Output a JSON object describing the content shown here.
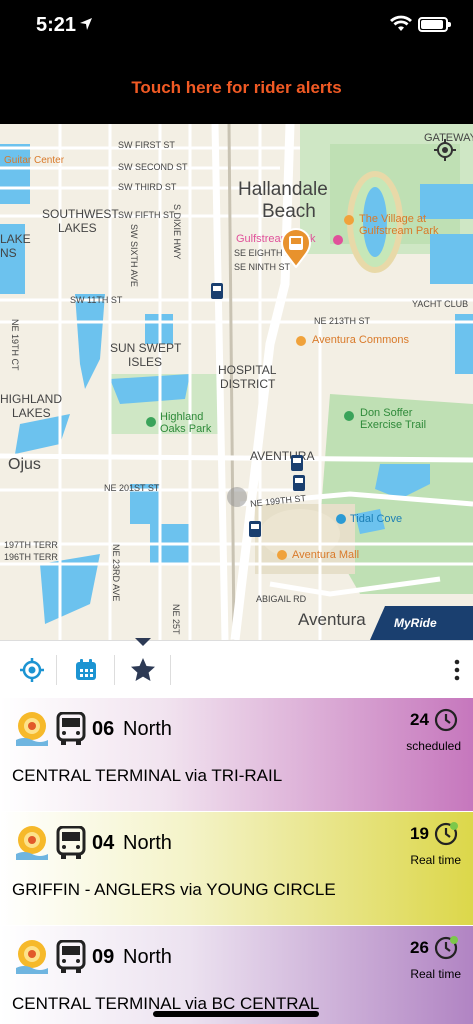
{
  "status_bar": {
    "time": "5:21"
  },
  "alert_banner": {
    "text": "Touch here for rider alerts"
  },
  "map": {
    "labels": {
      "guitar_center": "Guitar Center",
      "sw_first_st": "SW FIRST ST",
      "sw_second_st": "SW SECOND ST",
      "sw_third_st": "SW THIRD ST",
      "sw_fifth_st": "SW FIFTH ST",
      "s_dixie_hwy": "S DIXIE HWY",
      "hallandale": "Hallandale",
      "beach": "Beach",
      "gateway": "GATEWAY",
      "southwest": "SOUTHWEST",
      "lakes": "LAKES",
      "lake_partial": "LAKE",
      "ns_partial": "NS",
      "gulfstream_park": "Gulfstream Park",
      "the_village_at": "The Village at",
      "gulfstream_park2": "Gulfstream Park",
      "se_eighth_st": "SE EIGHTH ST",
      "se_ninth_st": "SE NINTH ST",
      "sw_sixth_ave": "SW SIXTH AVE",
      "sw_11th_st": "SW 11TH ST",
      "yacht_club": "YACHT CLUB",
      "ne_213th_st": "NE 213TH ST",
      "ne_19th_ct": "NE 19TH CT",
      "sun_swept": "SUN SWEPT",
      "isles": "ISLES",
      "aventura_commons": "Aventura Commons",
      "hospital": "HOSPITAL",
      "district": "DISTRICT",
      "highland": "HIGHLAND",
      "lakes2": "LAKES",
      "highland_oaks_1": "Highland",
      "highland_oaks_2": "Oaks Park",
      "don_soffer_1": "Don Soffer",
      "don_soffer_2": "Exercise Trail",
      "ojus": "Ojus",
      "aventura": "AVENTURA",
      "ne_201st_st": "NE 201ST ST",
      "ne_199th_st": "NE 199TH ST",
      "tidal_cove": "Tidal Cove",
      "terr_197": "197TH TERR",
      "terr_196": "196TH TERR",
      "ne_23rd_ave": "NE 23RD AVE",
      "ne_25th": "NE 25T",
      "aventura_mall": "Aventura Mall",
      "abigail_rd": "ABIGAIL RD",
      "aventura2": "Aventura",
      "myride": "MyRide"
    }
  },
  "cards": [
    {
      "route": "06",
      "direction": "North",
      "destination": "CENTRAL TERMINAL via TRI-RAIL",
      "eta": "24",
      "status": "scheduled",
      "realtime": false
    },
    {
      "route": "04",
      "direction": "North",
      "destination": "GRIFFIN - ANGLERS via YOUNG CIRCLE",
      "eta": "19",
      "status": "Real time",
      "realtime": true
    },
    {
      "route": "09",
      "direction": "North",
      "destination": "CENTRAL TERMINAL via BC CENTRAL",
      "eta": "26",
      "status": "Real time",
      "realtime": true
    }
  ],
  "icons": {
    "location": "location-arrow-icon",
    "nearby": "crosshair-icon",
    "schedule": "calendar-icon",
    "favorites": "star-icon",
    "more": "more-vertical-icon",
    "route": "sun-logo-icon",
    "bus": "bus-icon",
    "clock": "clock-icon"
  },
  "colors": {
    "alert_text": "#f15a24",
    "toolbar_blue": "#1c94d2",
    "star_navy": "#2d3a55",
    "card_purple": "#c677bd",
    "card_yellow": "#dcd74a",
    "card_violet": "#b184c3",
    "realtime_dot": "#7cc84a"
  }
}
